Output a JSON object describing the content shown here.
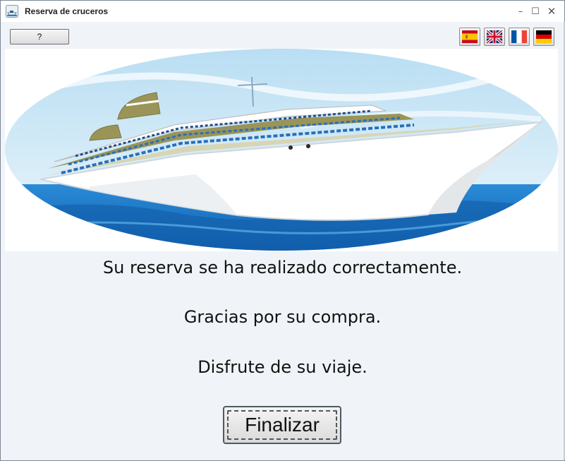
{
  "window": {
    "title": "Reserva de cruceros",
    "controls": {
      "minimize": "–",
      "maximize": "☐",
      "close": "✕"
    }
  },
  "toolbar": {
    "help_label": "?",
    "languages": [
      {
        "code": "es",
        "icon": "spain-flag-icon"
      },
      {
        "code": "en",
        "icon": "uk-flag-icon"
      },
      {
        "code": "fr",
        "icon": "france-flag-icon"
      },
      {
        "code": "de",
        "icon": "germany-flag-icon"
      }
    ]
  },
  "banner": {
    "icon": "cruise-ship-illustration"
  },
  "messages": {
    "line1": "Su reserva se ha realizado correctamente.",
    "line2": "Gracias por su compra.",
    "line3": "Disfrute de su viaje."
  },
  "actions": {
    "finish_label": "Finalizar"
  },
  "colors": {
    "sea": "#1b74c8",
    "sky": "#cfe8f6",
    "hull": "#ffffff",
    "deck": "#9a9458"
  }
}
